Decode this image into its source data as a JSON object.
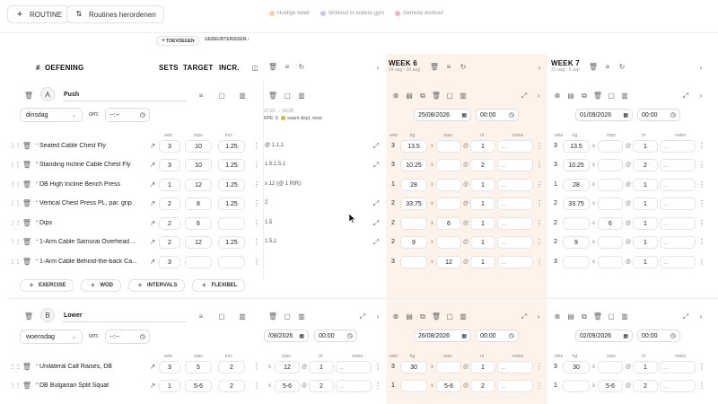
{
  "topbar": {
    "routine_label": "ROUTINE",
    "reorder_label": "Routines herordenen",
    "legend": [
      {
        "label": "Huidige week",
        "color": "#f6cfa8"
      },
      {
        "label": "Workout in andere gym",
        "color": "#cfc3ef"
      },
      {
        "label": "Gemiste workout",
        "color": "#f2b2bf"
      }
    ],
    "add_label": "TOEVOEGEN",
    "events_label": "GEBEURTENISSEN"
  },
  "columns": {
    "num": "#",
    "exercise": "OEFENING",
    "sets": "SETS",
    "target": "TARGET",
    "incr": "INCR."
  },
  "weeks": [
    {
      "title": "WEEK 6",
      "range": "24 aug - 30 aug"
    },
    {
      "title": "WEEK 7",
      "range": "31 aug - 6 sep"
    }
  ],
  "prev_week": {
    "time": "17:31 → 18:29",
    "note": "RPE: 6. 😊 wasnt slept, mow"
  },
  "sub_headers": {
    "sets": "sets",
    "kg": "kg",
    "reps": "reps",
    "rir": "rir",
    "notes": "notes",
    "incr": "incr"
  },
  "routines": [
    {
      "letter": "A",
      "name": "Push",
      "day": "dinsdag",
      "time_placeholder": "--:--",
      "om_label": "om:",
      "week6_date": "25/08/2026",
      "week7_date": "01/09/2026",
      "time": "00:00",
      "exercises": [
        {
          "name": "Seated Cable Chest Fly",
          "sets": "3",
          "target": "10",
          "incr": "1.25",
          "prev": "@ 1,1,1",
          "w6": {
            "sets": "3",
            "kg": "13.5",
            "reps": "",
            "rir": "1"
          },
          "w7": {
            "sets": "3",
            "kg": "13.5",
            "reps": "",
            "rir": "1"
          }
        },
        {
          "name": "Standing Incline Cable Chest Fly",
          "sets": "3",
          "target": "10",
          "incr": "1.25",
          "prev": "1.5,1.5,1",
          "w6": {
            "sets": "3",
            "kg": "10.25",
            "reps": "",
            "rir": "2"
          },
          "w7": {
            "sets": "3",
            "kg": "10.25",
            "reps": "",
            "rir": "2"
          }
        },
        {
          "name": "DB High Incline Bench Press",
          "sets": "1",
          "target": "12",
          "incr": "1.25",
          "prev": "x 12 (@ 1 RIR)",
          "w6": {
            "sets": "1",
            "kg": "28",
            "reps": "",
            "rir": "1"
          },
          "w7": {
            "sets": "1",
            "kg": "28",
            "reps": "",
            "rir": "1"
          }
        },
        {
          "name": "Vertical Chest Press PL, par. grip",
          "sets": "2",
          "target": "8",
          "incr": "1.25",
          "prev": "2",
          "w6": {
            "sets": "2",
            "kg": "33.75",
            "reps": "",
            "rir": "1"
          },
          "w7": {
            "sets": "2",
            "kg": "33.75",
            "reps": "",
            "rir": "1"
          }
        },
        {
          "name": "Dips",
          "sets": "2",
          "target": "6",
          "incr": "",
          "prev": "1.5",
          "w6": {
            "sets": "2",
            "kg": "",
            "reps": "6",
            "rir": "1"
          },
          "w7": {
            "sets": "2",
            "kg": "",
            "reps": "6",
            "rir": "1"
          }
        },
        {
          "name": "1-Arm Cable Samurai Overhead ...",
          "sets": "2",
          "target": "12",
          "incr": "1.25",
          "prev": "1.5,1",
          "w6": {
            "sets": "2",
            "kg": "9",
            "reps": "",
            "rir": "1"
          },
          "w7": {
            "sets": "2",
            "kg": "9",
            "reps": "",
            "rir": "1"
          }
        },
        {
          "name": "1-Arm Cable Behind-the-back Ca...",
          "sets": "3",
          "target": "",
          "incr": "",
          "prev": "",
          "w6": {
            "sets": "3",
            "kg": "",
            "reps": "12",
            "rir": "1"
          },
          "w7": {
            "sets": "3",
            "kg": "",
            "reps": "",
            "rir": "1"
          }
        }
      ],
      "add_buttons": [
        "EXERCISE",
        "WOD",
        "INTERVALS",
        "FLEXIBEL"
      ]
    },
    {
      "letter": "B",
      "name": "Lower",
      "day": "woensdag",
      "time_placeholder": "--:--",
      "om_label": "om:",
      "prev_date": "/08/2026",
      "week6_date": "26/08/2026",
      "week7_date": "02/09/2026",
      "time": "00:00",
      "exercises": [
        {
          "name": "Unilateral Calf Raises, DB",
          "sets": "3",
          "target": "5",
          "incr": "2",
          "prev": {
            "reps": "12",
            "rir": "1"
          },
          "w6": {
            "sets": "3",
            "kg": "30",
            "reps": "",
            "rir": "1"
          },
          "w7": {
            "sets": "3",
            "kg": "30",
            "reps": "",
            "rir": "1"
          }
        },
        {
          "name": "DB Bulgarian Split Squat",
          "sets": "1",
          "target": "5-6",
          "incr": "2",
          "prev": {
            "reps": "5-6",
            "rir": "2"
          },
          "w6": {
            "sets": "1",
            "kg": "",
            "reps": "5-6",
            "rir": "2"
          },
          "w7": {
            "sets": "1",
            "kg": "",
            "reps": "5-6",
            "rir": "2"
          }
        }
      ]
    }
  ]
}
